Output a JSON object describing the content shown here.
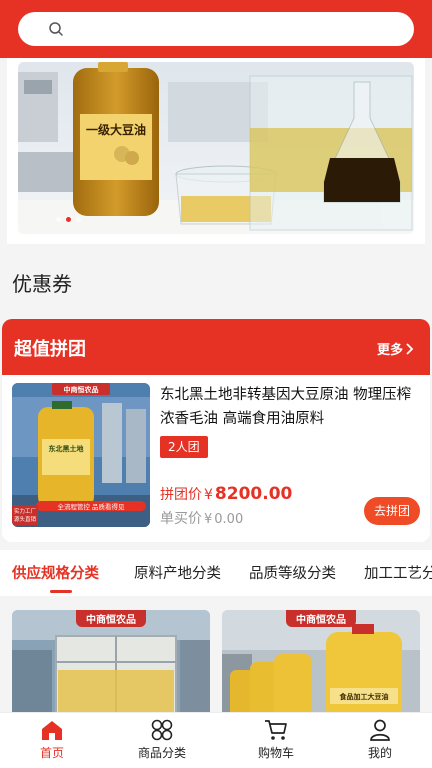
{
  "search": {
    "placeholder": ""
  },
  "banner": {
    "jug_label": "一级大豆油",
    "slide_count": 3,
    "active_slide": 2
  },
  "coupon": {
    "title": "优惠券"
  },
  "group_buy": {
    "title": "超值拼团",
    "more_label": "更多",
    "product": {
      "image_brand": "中商恒农品",
      "image_bottle_label": "东北黑土地",
      "image_badge": "全流程管控  品质看得见",
      "image_left_badge_1": "实力工厂",
      "image_left_badge_2": "源头直销",
      "name": "东北黑土地非转基因大豆原油 物理压榨浓香毛油 高端食用油原料",
      "tag": "2人团",
      "group_price_label": "拼团价",
      "currency": "¥",
      "group_price": "8200.00",
      "single_price_label": "单买价",
      "single_price": "0.00",
      "join_label": "去拼团"
    }
  },
  "category_tabs": [
    {
      "label": "供应规格分类",
      "active": true
    },
    {
      "label": "原料产地分类",
      "active": false
    },
    {
      "label": "品质等级分类",
      "active": false
    },
    {
      "label": "加工工艺分类",
      "active": false
    }
  ],
  "cards": [
    {
      "brand": "中商恒农品"
    },
    {
      "brand": "中商恒农品",
      "bottle_label": "食品加工大豆油"
    }
  ],
  "bottom_nav": [
    {
      "label": "首页",
      "icon": "home-icon",
      "active": true
    },
    {
      "label": "商品分类",
      "icon": "category-icon",
      "active": false
    },
    {
      "label": "购物车",
      "icon": "cart-icon",
      "active": false
    },
    {
      "label": "我的",
      "icon": "user-icon",
      "active": false
    }
  ],
  "colors": {
    "brand_red": "#e53225",
    "button_orange": "#ef4b26",
    "muted_gray": "#9a9a9a"
  }
}
